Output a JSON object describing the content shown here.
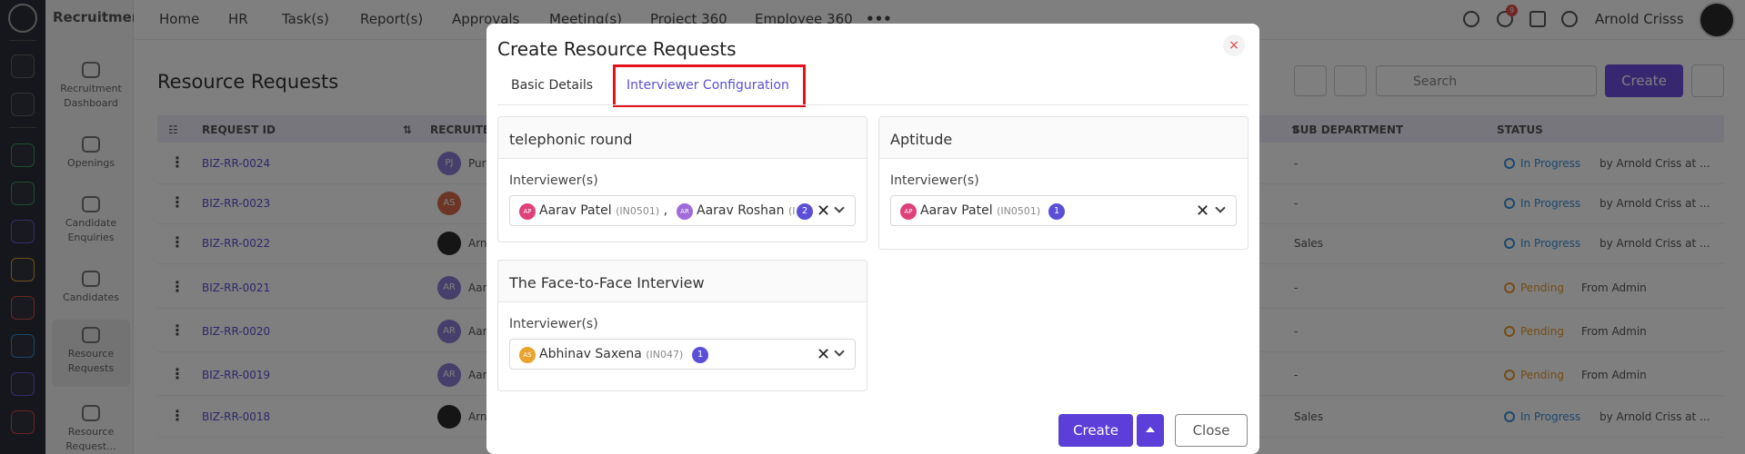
{
  "app": {
    "module": "Recruitment",
    "user": "Arnold Crisss",
    "notification_count": "9"
  },
  "top_nav": [
    "Home",
    "HR",
    "Task(s)",
    "Report(s)",
    "Approvals",
    "Meeting(s)",
    "Project 360",
    "Employee 360"
  ],
  "sidebar": [
    {
      "label": "Recruitment Dashboard",
      "icon": "monitor-icon"
    },
    {
      "label": "Openings",
      "icon": "user-briefcase-icon"
    },
    {
      "label": "Candidate Enquiries",
      "icon": "phone-icon"
    },
    {
      "label": "Candidates",
      "icon": "users-icon"
    },
    {
      "label": "Resource Requests",
      "icon": "user-lock-icon"
    },
    {
      "label": "Resource Request...",
      "icon": "user-square-icon"
    }
  ],
  "page": {
    "title": "Resource Requests",
    "search_placeholder": "Search",
    "create_label": "Create"
  },
  "table": {
    "headers": {
      "request_id": "REQUEST ID",
      "recruiter": "RECRUITE",
      "sub_department": "SUB DEPARTMENT",
      "status": "STATUS"
    },
    "rows": [
      {
        "id": "BIZ-RR-0024",
        "avatar": "PJ",
        "recruiter": "Pur",
        "sub_dept": "-",
        "status": "In Progress",
        "by": "by Arnold Criss at ..."
      },
      {
        "id": "BIZ-RR-0023",
        "avatar": "AS",
        "recruiter": "",
        "sub_dept": "-",
        "status": "In Progress",
        "by": "by Arnold Criss at ..."
      },
      {
        "id": "BIZ-RR-0022",
        "avatar": "",
        "recruiter": "Arn",
        "sub_dept": "Sales",
        "status": "In Progress",
        "by": "by Arnold Criss at ..."
      },
      {
        "id": "BIZ-RR-0021",
        "avatar": "AR",
        "recruiter": "Aar",
        "sub_dept": "-",
        "status": "Pending",
        "by": "From Admin"
      },
      {
        "id": "BIZ-RR-0020",
        "avatar": "AR",
        "recruiter": "Aar",
        "sub_dept": "-",
        "status": "Pending",
        "by": "From Admin"
      },
      {
        "id": "BIZ-RR-0019",
        "avatar": "AR",
        "recruiter": "Aar",
        "sub_dept": "-",
        "status": "Pending",
        "by": "From Admin"
      },
      {
        "id": "BIZ-RR-0018",
        "avatar": "",
        "recruiter": "Arn",
        "sub_dept": "Sales",
        "status": "In Progress",
        "by": "by Arnold Criss at ..."
      }
    ]
  },
  "modal": {
    "title": "Create Resource Requests",
    "close_symbol": "×",
    "tabs": [
      "Basic Details",
      "Interviewer Configuration"
    ],
    "rounds": [
      {
        "name": "telephonic round",
        "label": "Interviewer(s)",
        "chips": [
          {
            "initials": "AP",
            "name": "Aarav Patel",
            "code": "(IN0501)"
          },
          {
            "initials": "AR",
            "name": "Aarav Roshan",
            "code": "(I"
          }
        ],
        "count": "2"
      },
      {
        "name": "Aptitude",
        "label": "Interviewer(s)",
        "chips": [
          {
            "initials": "AP",
            "name": "Aarav Patel",
            "code": "(IN0501)"
          }
        ],
        "count": "1"
      },
      {
        "name": "The Face-to-Face Interview",
        "label": "Interviewer(s)",
        "chips": [
          {
            "initials": "AS",
            "name": "Abhinav Saxena",
            "code": "(IN047)"
          }
        ],
        "count": "1"
      }
    ],
    "clear_symbol": "✕",
    "create_label": "Create",
    "close_label": "Close"
  },
  "colors": {
    "accent": "#5b4fd8",
    "highlight": "#e3121d",
    "in_progress": "#3f8fd8",
    "pending": "#e89a2c"
  }
}
